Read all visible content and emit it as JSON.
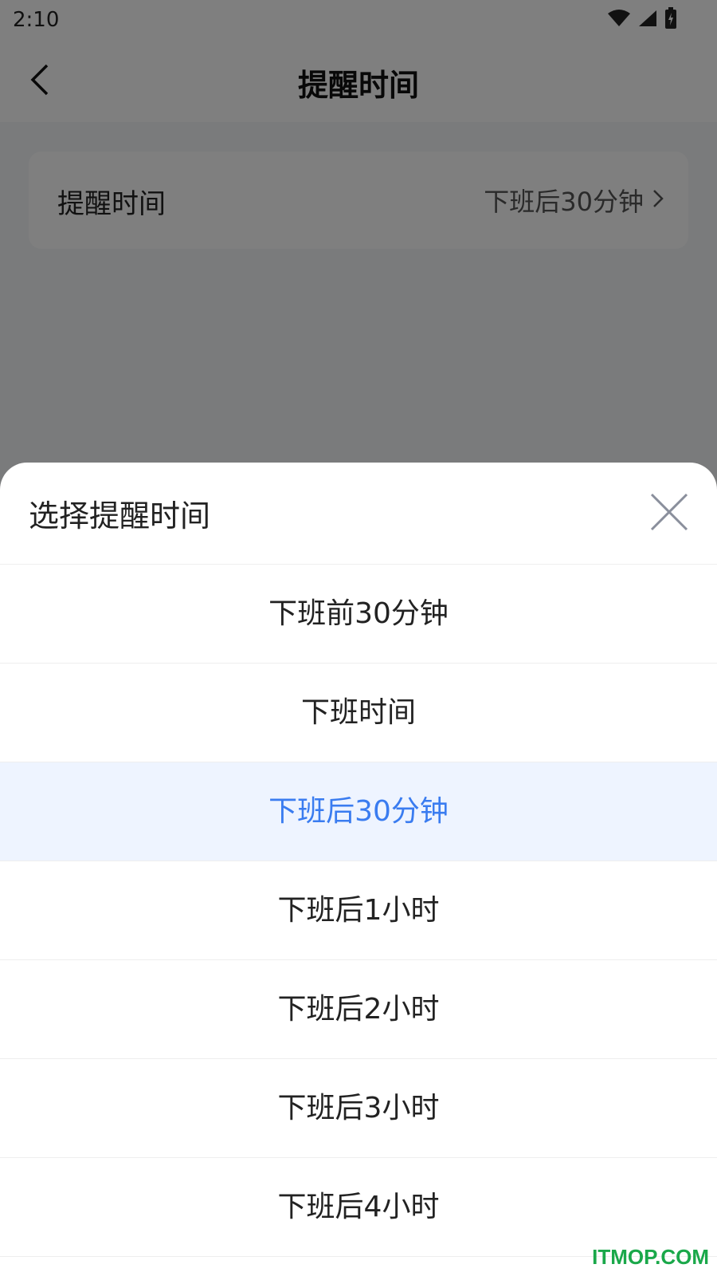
{
  "status_bar": {
    "time": "2:10"
  },
  "header": {
    "title": "提醒时间"
  },
  "setting": {
    "label": "提醒时间",
    "value": "下班后30分钟"
  },
  "sheet": {
    "title": "选择提醒时间",
    "options": [
      {
        "label": "下班前30分钟",
        "selected": false
      },
      {
        "label": "下班时间",
        "selected": false
      },
      {
        "label": "下班后30分钟",
        "selected": true
      },
      {
        "label": "下班后1小时",
        "selected": false
      },
      {
        "label": "下班后2小时",
        "selected": false
      },
      {
        "label": "下班后3小时",
        "selected": false
      },
      {
        "label": "下班后4小时",
        "selected": false
      }
    ]
  },
  "watermark": "ITMOP.COM",
  "colors": {
    "accent": "#3a7cf0",
    "selected_bg": "#eef4ff",
    "watermark": "#1aa84a"
  }
}
